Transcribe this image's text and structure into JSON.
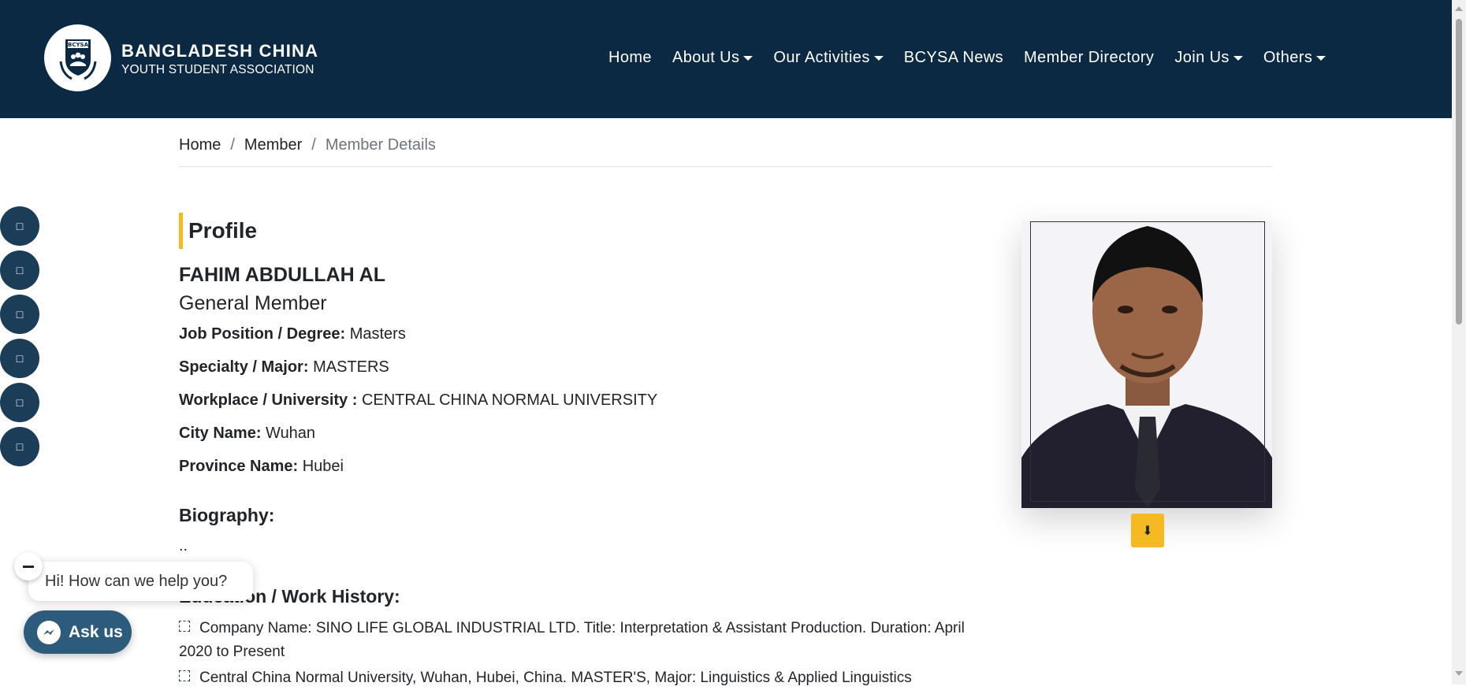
{
  "brand": {
    "logo_text": "BCYSA",
    "title": "BANGLADESH CHINA",
    "subtitle": "YOUTH STUDENT ASSOCIATION"
  },
  "nav": {
    "items": [
      {
        "label": "Home",
        "dropdown": false
      },
      {
        "label": "About Us",
        "dropdown": true
      },
      {
        "label": "Our Activities",
        "dropdown": true
      },
      {
        "label": "BCYSA News",
        "dropdown": false
      },
      {
        "label": "Member Directory",
        "dropdown": false
      },
      {
        "label": "Join Us",
        "dropdown": true
      },
      {
        "label": "Others",
        "dropdown": true
      }
    ]
  },
  "breadcrumb": {
    "home": "Home",
    "member": "Member",
    "current": "Member Details",
    "separator": "/"
  },
  "profile": {
    "heading": "Profile",
    "name": "FAHIM ABDULLAH AL",
    "member_type": "General Member",
    "fields": [
      {
        "label": "Job Position / Degree:",
        "value": "Masters"
      },
      {
        "label": "Specialty / Major:",
        "value": "MASTERS"
      },
      {
        "label": "Workplace / University :",
        "value": "CENTRAL CHINA NORMAL UNIVERSITY"
      },
      {
        "label": "City Name:",
        "value": "Wuhan"
      },
      {
        "label": "Province Name:",
        "value": "Hubei"
      }
    ],
    "biography_title": "Biography:",
    "biography_text": "..",
    "history_title": "Education / Work History:",
    "history": [
      "Company Name: SINO LIFE GLOBAL INDUSTRIAL LTD. Title: Interpretation & Assistant Production. Duration: April 2020 to Present",
      "Central China Normal University, Wuhan, Hubei, China. MASTER'S, Major: Linguistics & Applied Linguistics"
    ]
  },
  "photo": {
    "download_icon": "download-icon"
  },
  "social": {
    "icons": [
      "facebook-icon",
      "twitter-icon",
      "linkedin-icon",
      "youtube-icon",
      "instagram-icon",
      "email-icon"
    ]
  },
  "chat": {
    "greeting": "Hi! How can we help you?",
    "button_label": "Ask us"
  },
  "colors": {
    "nav_bg": "#0b2942",
    "accent": "#f5b921",
    "social_bg": "#1c3d57",
    "chat_btn": "#2c5b7b"
  }
}
